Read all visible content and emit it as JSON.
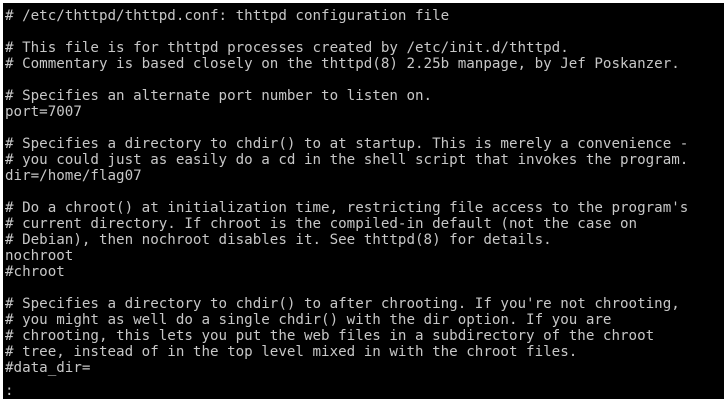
{
  "terminal": {
    "foreground": "#c7c7c7",
    "background": "#000000",
    "lines": [
      "# /etc/thttpd/thttpd.conf: thttpd configuration file",
      "",
      "# This file is for thttpd processes created by /etc/init.d/thttpd.",
      "# Commentary is based closely on the thttpd(8) 2.25b manpage, by Jef Poskanzer.",
      "",
      "# Specifies an alternate port number to listen on.",
      "port=7007",
      "",
      "# Specifies a directory to chdir() to at startup. This is merely a convenience -",
      "# you could just as easily do a cd in the shell script that invokes the program.",
      "dir=/home/flag07",
      "",
      "# Do a chroot() at initialization time, restricting file access to the program's",
      "# current directory. If chroot is the compiled-in default (not the case on",
      "# Debian), then nochroot disables it. See thttpd(8) for details.",
      "nochroot",
      "#chroot",
      "",
      "# Specifies a directory to chdir() to after chrooting. If you're not chrooting,",
      "# you might as well do a single chdir() with the dir option. If you are",
      "# chrooting, this lets you put the web files in a subdirectory of the chroot",
      "# tree, instead of in the top level mixed in with the chroot files.",
      "#data_dir="
    ],
    "prompt": ":"
  }
}
